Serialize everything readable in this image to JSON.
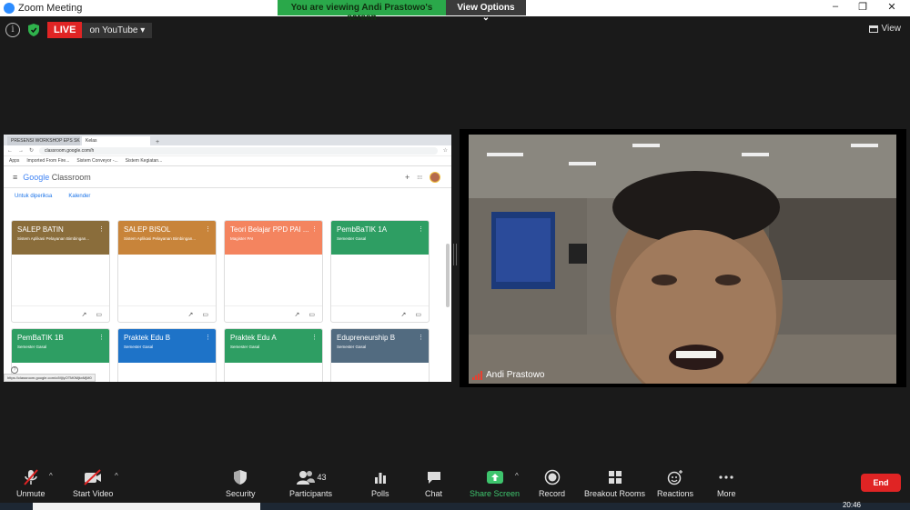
{
  "window": {
    "title": "Zoom Meeting",
    "controls": [
      "–",
      "❐",
      "✕"
    ]
  },
  "banner": {
    "viewing_text": "You are viewing Andi Prastowo's screen",
    "view_options": "View Options ⌄"
  },
  "top_bar": {
    "live_label": "LIVE",
    "live_destination": "on YouTube ▾",
    "view_label": "View"
  },
  "shared_screen": {
    "browser": {
      "tabs": [
        "PRESENSI WORKSHOP EPS SKS",
        "Kelas"
      ],
      "new_tab": "+",
      "address": "classroom.google.com/h",
      "bookmarks": [
        "Apps",
        "Imported From Fire...",
        "Sistem Conveyor -...",
        "Sistem Kegiatan..."
      ]
    },
    "classroom": {
      "menu_glyph": "≡",
      "logo_google": "Google",
      "logo_classroom": " Classroom",
      "add_glyph": "+",
      "apps_glyph": "⁝⁝⁝",
      "links": [
        "Untuk diperiksa",
        "Kalender"
      ],
      "cards": [
        {
          "title": "SALEP BATIN",
          "subtitle": "Sistem Aplikasi Pelayanan Bimbingan...",
          "color": "#8a6d3b"
        },
        {
          "title": "SALEP BISOL",
          "subtitle": "Sistem Aplikasi Pelayanan Bimbingan...",
          "color": "#c8843a"
        },
        {
          "title": "Teori Belajar PPD PAI ...",
          "subtitle": "Magister PAI",
          "color": "#f4845f"
        },
        {
          "title": "PembBaTIK 1A",
          "subtitle": "Semester Gasal",
          "color": "#2e9e63"
        },
        {
          "title": "PemBaTIK 1B",
          "subtitle": "Semester Gasal",
          "color": "#2e9e63"
        },
        {
          "title": "Praktek Edu B",
          "subtitle": "Semester Gasal",
          "color": "#1e73c8"
        },
        {
          "title": "Praktek Edu A",
          "subtitle": "Semester Gasal",
          "color": "#2e9e63"
        },
        {
          "title": "Edupreneurship B",
          "subtitle": "Semester Gasal",
          "color": "#526b80"
        }
      ],
      "status_url": "https://classroom.google.com/c/MjIyOTM0MjkxMjM0"
    }
  },
  "participant": {
    "name": "Andi Prastowo"
  },
  "toolbar": {
    "unmute": "Unmute",
    "start_video": "Start Video",
    "security": "Security",
    "participants": "Participants",
    "participants_count": "43",
    "polls": "Polls",
    "chat": "Chat",
    "share_screen": "Share Screen",
    "record": "Record",
    "breakout_rooms": "Breakout Rooms",
    "reactions": "Reactions",
    "more": "More",
    "end": "End",
    "caret": "^"
  },
  "taskbar": {
    "clock": "20:46"
  },
  "colors": {
    "live_red": "#e02424",
    "zoom_green": "#3ec46d",
    "banner_green": "#2aa84a"
  }
}
